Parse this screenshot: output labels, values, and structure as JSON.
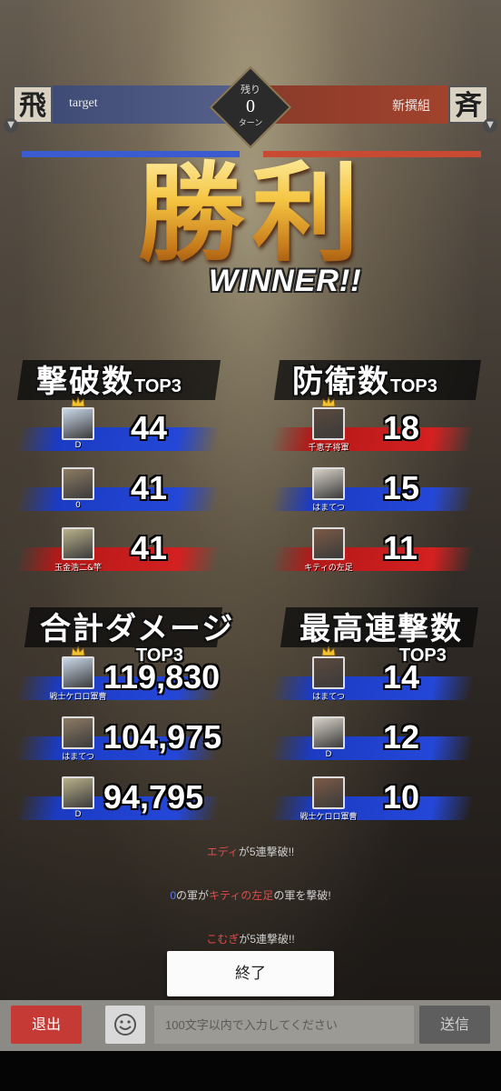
{
  "header": {
    "left_kanji": "飛",
    "left_team": "target",
    "remaining_label": "残り",
    "remaining_value": "0",
    "remaining_unit": "ターン",
    "right_team": "新撰組",
    "right_kanji": "斉"
  },
  "result": {
    "victory_kanji": "勝利",
    "winner_label": "WINNER!!"
  },
  "rankings": {
    "top3_label": "TOP3",
    "kills": {
      "title": "撃破数",
      "entries": [
        {
          "name": "D",
          "value": "44",
          "team": "blue"
        },
        {
          "name": "0",
          "value": "41",
          "team": "blue"
        },
        {
          "name": "玉金浩二&竿",
          "value": "41",
          "team": "red"
        }
      ]
    },
    "defense": {
      "title": "防衛数",
      "entries": [
        {
          "name": "千恵子将軍",
          "value": "18",
          "team": "red"
        },
        {
          "name": "はまてつ",
          "value": "15",
          "team": "blue"
        },
        {
          "name": "キティの左足",
          "value": "11",
          "team": "red"
        }
      ]
    },
    "damage": {
      "title": "合計ダメージ",
      "entries": [
        {
          "name": "戦士ケロロ軍曹",
          "value": "119,830",
          "team": "blue"
        },
        {
          "name": "はまてつ",
          "value": "104,975",
          "team": "blue"
        },
        {
          "name": "D",
          "value": "94,795",
          "team": "blue"
        }
      ]
    },
    "combo": {
      "title": "最高連撃数",
      "entries": [
        {
          "name": "はまてつ",
          "value": "14",
          "team": "blue"
        },
        {
          "name": "D",
          "value": "12",
          "team": "blue"
        },
        {
          "name": "戦士ケロロ軍曹",
          "value": "10",
          "team": "blue"
        }
      ]
    }
  },
  "chat_log": {
    "line1_name": "エディ",
    "line1_text": "が5連撃破!!",
    "line2_a": "0",
    "line2_b": "の軍が",
    "line2_c": "キティの左足",
    "line2_d": "の軍を撃破!",
    "line3_name": "こむぎ",
    "line3_text": "が5連撃破!!"
  },
  "end_button": "終了",
  "bottom": {
    "exit_label": "退出",
    "input_placeholder": "100文字以内で入力してください",
    "send_label": "送信"
  },
  "colors": {
    "blue_team": "#2447d8",
    "red_team": "#d42020",
    "gold": "#f5c542"
  }
}
